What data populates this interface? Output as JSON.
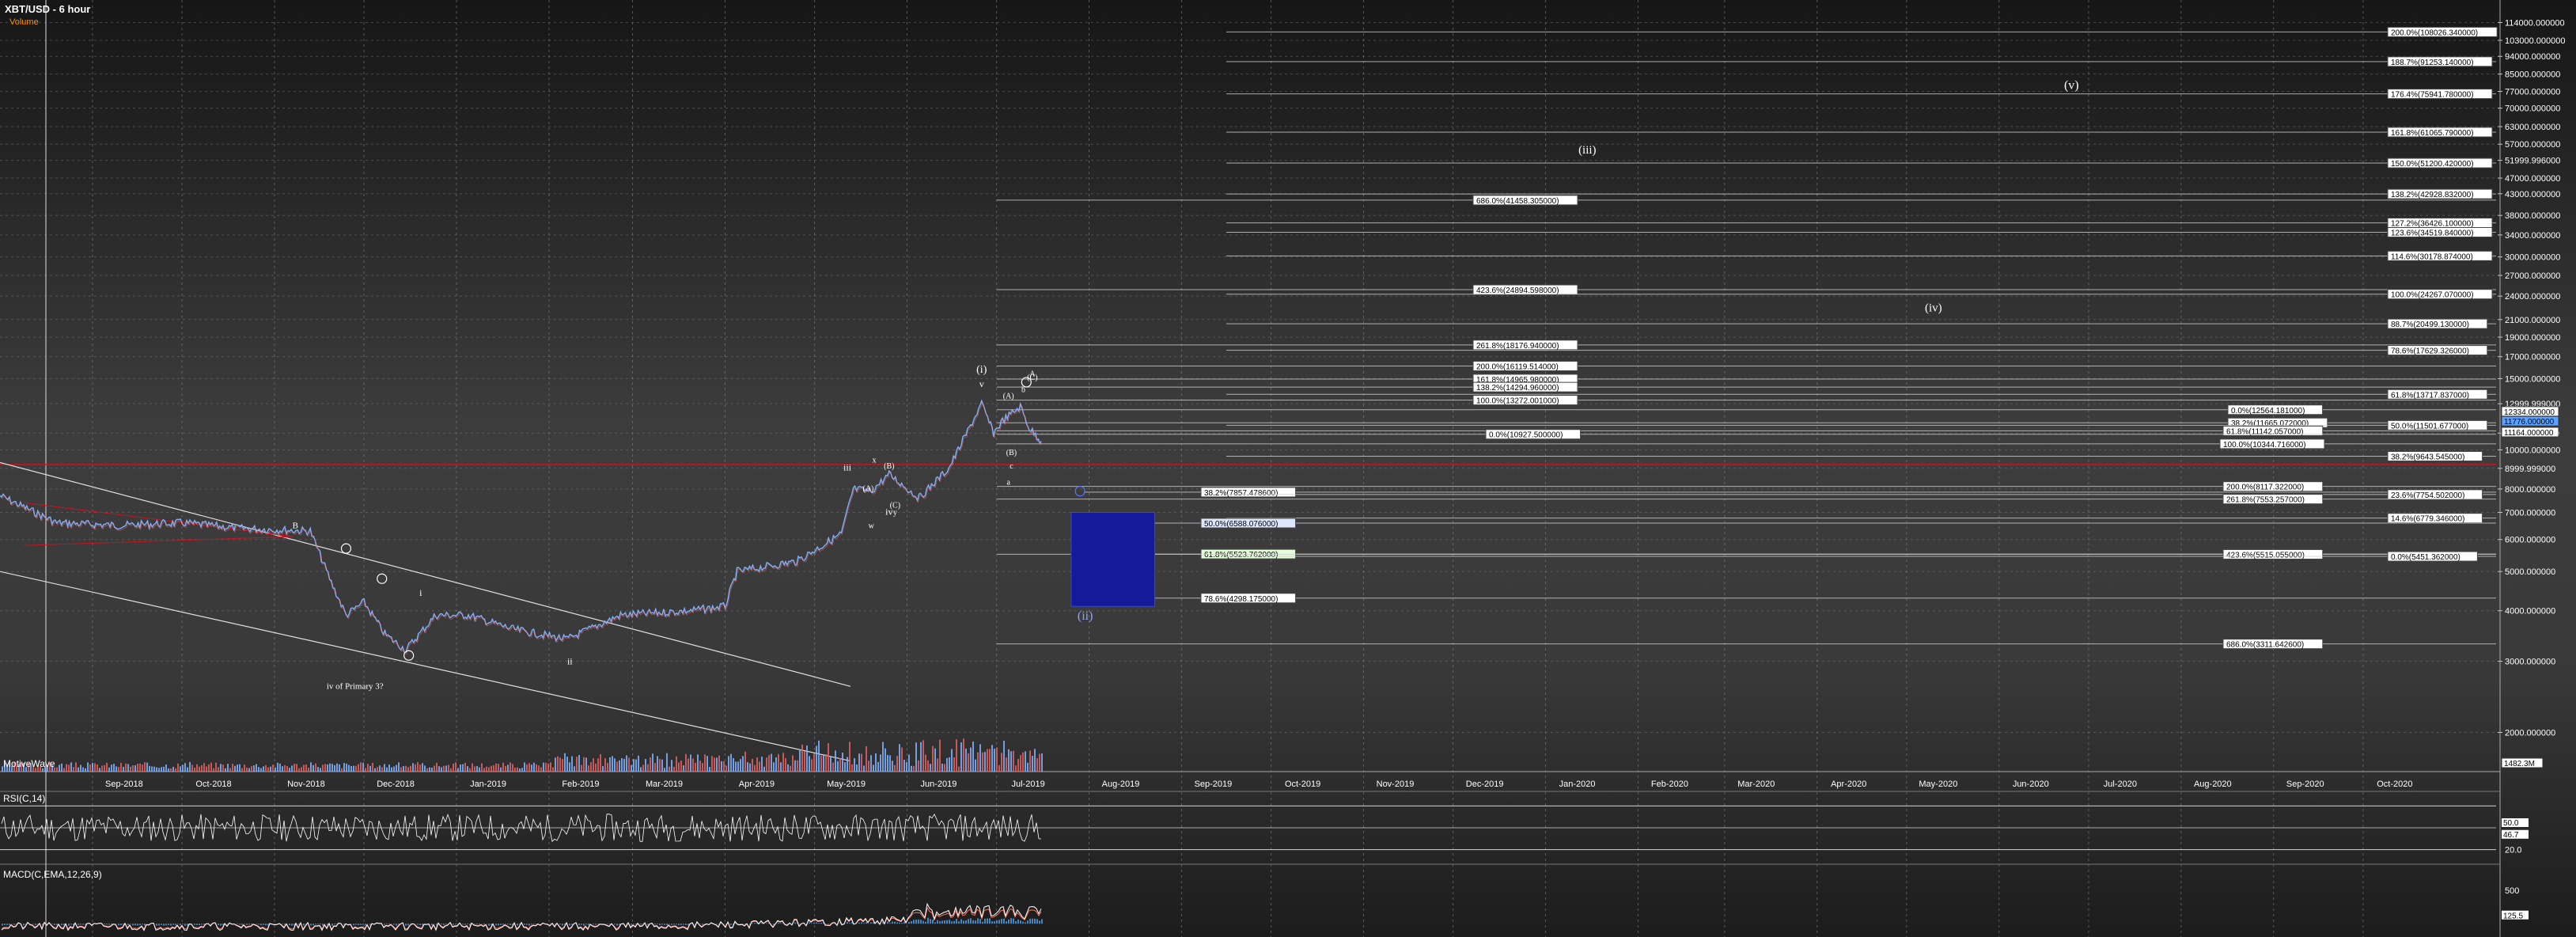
{
  "header": {
    "title": "XBT/USD - 6 hour",
    "volume_label": "Volume"
  },
  "logo": "MotiveWave",
  "price_axis": {
    "ticks": [
      "114000.000000",
      "103000.000000",
      "94000.000000",
      "85000.000000",
      "77000.000000",
      "70000.000000",
      "63000.000000",
      "57000.000000",
      "51999.996000",
      "47000.000000",
      "43000.000000",
      "38000.000000",
      "34000.000000",
      "30000.000000",
      "27000.000000",
      "24000.000000",
      "21000.000000",
      "19000.000000",
      "17000.000000",
      "15000.000000",
      "12999.999000",
      "11000.000000",
      "10000.000000",
      "8999.999000",
      "8000.000000",
      "7000.000000",
      "6000.000000",
      "5000.000000",
      "4000.000000",
      "3000.000000",
      "2000.000000"
    ],
    "current_badges": [
      "12334.000000",
      "11776.000000",
      "11164.000000"
    ],
    "volume_badge": "1482.3M"
  },
  "time_axis": [
    "Sep-2018",
    "Oct-2018",
    "Nov-2018",
    "Dec-2018",
    "Jan-2019",
    "Feb-2019",
    "Mar-2019",
    "Apr-2019",
    "May-2019",
    "Jun-2019",
    "Jul-2019",
    "Aug-2019",
    "Sep-2019",
    "Oct-2019",
    "Nov-2019",
    "Dec-2019",
    "Jan-2020",
    "Feb-2020",
    "Mar-2020",
    "Apr-2020",
    "May-2020",
    "Jun-2020",
    "Jul-2020",
    "Aug-2020",
    "Sep-2020",
    "Oct-2020"
  ],
  "rsi": {
    "title": "RSI(C,14)",
    "ticks": [
      "80.0",
      "20.0"
    ],
    "badges": [
      "50.0",
      "46.7"
    ]
  },
  "macd": {
    "title": "MACD(C,EMA,12,26,9)",
    "ticks": [
      "500",
      "0"
    ],
    "badge": "125.5"
  },
  "fib_labels": [
    {
      "text": "200.0%(108026.340000)",
      "price": 108026
    },
    {
      "text": "188.7%(91253.140000)",
      "price": 91253
    },
    {
      "text": "176.4%(75941.780000)",
      "price": 75941
    },
    {
      "text": "161.8%(61065.790000)",
      "price": 61065
    },
    {
      "text": "150.0%(51200.420000)",
      "price": 51200
    },
    {
      "text": "138.2%(42928.832000)",
      "price": 42928
    },
    {
      "text": "686.0%(41458.305000)",
      "price": 41458
    },
    {
      "text": "127.2%(36426.100000)",
      "price": 36426
    },
    {
      "text": "123.6%(34519.840000)",
      "price": 34519
    },
    {
      "text": "114.6%(30178.874000)",
      "price": 30178
    },
    {
      "text": "423.6%(24894.598000)",
      "price": 24894
    },
    {
      "text": "100.0%(24267.070000)",
      "price": 24267
    },
    {
      "text": "88.7%(20499.130000)",
      "price": 20499
    },
    {
      "text": "261.8%(18176.940000)",
      "price": 18176
    },
    {
      "text": "78.6%(17629.326000)",
      "price": 17629
    },
    {
      "text": "200.0%(16119.514000)",
      "price": 16119
    },
    {
      "text": "161.8%(14965.980000)",
      "price": 14965
    },
    {
      "text": "138.2%(14294.960000)",
      "price": 14294
    },
    {
      "text": "61.8%(13717.837000)",
      "price": 13717
    },
    {
      "text": "100.0%(13272.001000)",
      "price": 13272
    },
    {
      "text": "0.0%(12564.181000)",
      "price": 12564
    },
    {
      "text": "38.2%(11665.072000)",
      "price": 11665
    },
    {
      "text": "50.0%(11501.677000)",
      "price": 11501
    },
    {
      "text": "61.8%(11142.057000)",
      "price": 11142
    },
    {
      "text": "0.0%(10927.500000)",
      "price": 10927
    },
    {
      "text": "100.0%(10344.716000)",
      "price": 10344
    },
    {
      "text": "38.2%(9643.545000)",
      "price": 9643
    },
    {
      "text": "200.0%(8117.322000)",
      "price": 8117
    },
    {
      "text": "38.2%(7857.478600)",
      "price": 7857
    },
    {
      "text": "23.6%(7754.502000)",
      "price": 7754
    },
    {
      "text": "261.8%(7553.257000)",
      "price": 7553
    },
    {
      "text": "14.6%(6779.346000)",
      "price": 6779
    },
    {
      "text": "50.0%(6588.076000)",
      "price": 6588
    },
    {
      "text": "61.8%(5523.762000)",
      "price": 5523
    },
    {
      "text": "423.6%(5515.055000)",
      "price": 5515
    },
    {
      "text": "0.0%(5451.362000)",
      "price": 5451
    },
    {
      "text": "78.6%(4298.175000)",
      "price": 4298
    },
    {
      "text": "686.0%(3311.642600)",
      "price": 3311
    }
  ],
  "wave_labels": [
    "(v)",
    "(iii)",
    "(iv)",
    "(i)",
    "v",
    "iii",
    "iv",
    "ii",
    "i",
    "B",
    "iv of Primary 3?",
    "(ii)",
    "A",
    "B",
    "C",
    "(A)",
    "(B)",
    "(C)",
    "(a)",
    "(b)",
    "(c)",
    "a",
    "b",
    "c",
    "w",
    "x",
    "y"
  ],
  "chart_data": {
    "type": "line",
    "title": "XBT/USD - 6 hour",
    "ylabel": "",
    "xlabel": "",
    "yscale": "log",
    "ylim": [
      1600,
      125000
    ],
    "xlim": [
      "2018-08-01",
      "2020-10-31"
    ],
    "series": [
      {
        "dates": [
          "2018-08-01",
          "2018-08-20",
          "2018-09-10",
          "2018-10-01",
          "2018-10-20",
          "2018-11-13",
          "2018-11-20",
          "2018-11-25",
          "2018-12-01",
          "2018-12-08",
          "2018-12-15",
          "2018-12-25",
          "2019-01-05",
          "2019-01-20",
          "2019-02-07",
          "2019-02-25",
          "2019-03-20",
          "2019-04-01",
          "2019-04-05",
          "2019-04-25",
          "2019-05-10",
          "2019-05-14",
          "2019-05-20",
          "2019-05-26",
          "2019-06-05",
          "2019-06-15",
          "2019-06-26",
          "2019-06-30",
          "2019-07-03",
          "2019-07-09",
          "2019-07-12",
          "2019-07-16"
        ],
        "values": [
          7700,
          6600,
          6500,
          6600,
          6400,
          6300,
          4700,
          3900,
          4200,
          3500,
          3200,
          3900,
          3900,
          3600,
          3400,
          3900,
          4000,
          4100,
          5000,
          5300,
          6200,
          8000,
          7900,
          8700,
          7600,
          9000,
          13000,
          11000,
          11800,
          12800,
          11300,
          10500
        ]
      }
    ],
    "resistance_line_color": "#c8141e",
    "target_box": {
      "from": "2019-07-26",
      "to": "2019-08-23",
      "price_high": 7000,
      "price_low": 4100,
      "label": "(ii)",
      "color": "#141a9a"
    }
  }
}
